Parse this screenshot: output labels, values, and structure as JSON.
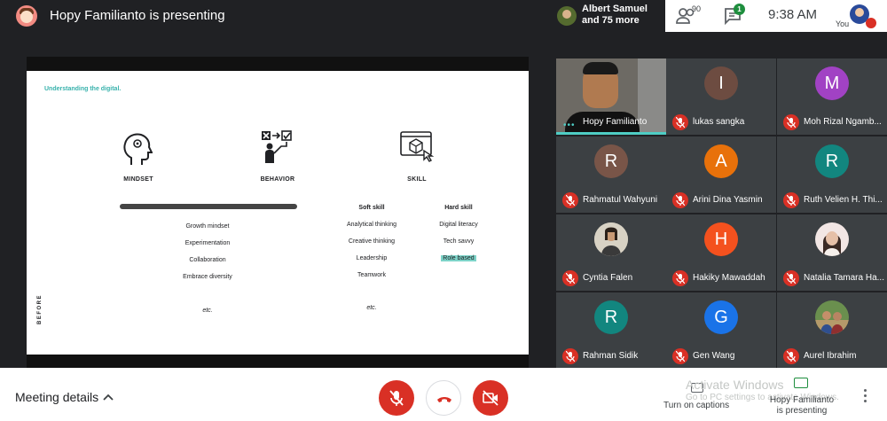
{
  "header": {
    "presenting_title": "Hopy Familianto is presenting",
    "participant_pill": {
      "line1": "Albert Samuel",
      "line2": "and 75 more"
    },
    "people_count": "90",
    "chat_badge": "1",
    "clock": "9:38  AM",
    "you_label": "You"
  },
  "slide": {
    "heading": "Understanding the digital.",
    "columns": [
      {
        "title": "MINDSET",
        "icon": "head-gears-icon"
      },
      {
        "title": "BEHAVIOR",
        "icon": "behavior-change-icon"
      },
      {
        "title": "SKILL",
        "icon": "skill-screen-icon"
      }
    ],
    "mindset_items": [
      "Growth mindset",
      "Experimentation",
      "Collaboration",
      "Embrace diversity"
    ],
    "mindset_etc": "etc.",
    "soft_skill": {
      "title": "Soft skill",
      "items": [
        "Analytical thinking",
        "Creative thinking",
        "Leadership",
        "Teamwork"
      ]
    },
    "hard_skill": {
      "title": "Hard skill",
      "items": [
        "Digital literacy",
        "Tech savvy",
        "Role based"
      ]
    },
    "skill_etc": "etc.",
    "side_label": "BEFORE",
    "highlight_color": "#7dd3c8"
  },
  "tiles": [
    {
      "name": "Hopy Familianto",
      "type": "video"
    },
    {
      "name": "lukas sangka",
      "initial": "I",
      "color": "#6d4c41"
    },
    {
      "name": "Moh Rizal Ngamb...",
      "initial": "M",
      "color": "#a142c4"
    },
    {
      "name": "Rahmatul Wahyuni",
      "initial": "R",
      "color": "#795548"
    },
    {
      "name": "Arini Dina Yasmin",
      "initial": "A",
      "color": "#e8710a"
    },
    {
      "name": "Ruth Velien H. Thi...",
      "initial": "R",
      "color": "#12867f"
    },
    {
      "name": "Cyntia Falen",
      "type": "photo"
    },
    {
      "name": "Hakiky Mawaddah",
      "initial": "H",
      "color": "#f4511e"
    },
    {
      "name": "Natalia Tamara Ha...",
      "type": "photo"
    },
    {
      "name": "Rahman Sidik",
      "initial": "R",
      "color": "#12867f"
    },
    {
      "name": "Gen Wang",
      "initial": "G",
      "color": "#1a73e8"
    },
    {
      "name": "Aurel Ibrahim",
      "type": "photo"
    }
  ],
  "footer": {
    "meeting_details": "Meeting details",
    "captions_label": "Turn on captions",
    "activate_title": "Activate Windows",
    "activate_sub": "Go to PC settings to activate Windows.",
    "presenting_line1": "Hopy Familianto",
    "presenting_line2": "is presenting"
  },
  "colors": {
    "red": "#d93025",
    "teal": "#4ecdc4",
    "tile_bg": "#3c4043"
  }
}
